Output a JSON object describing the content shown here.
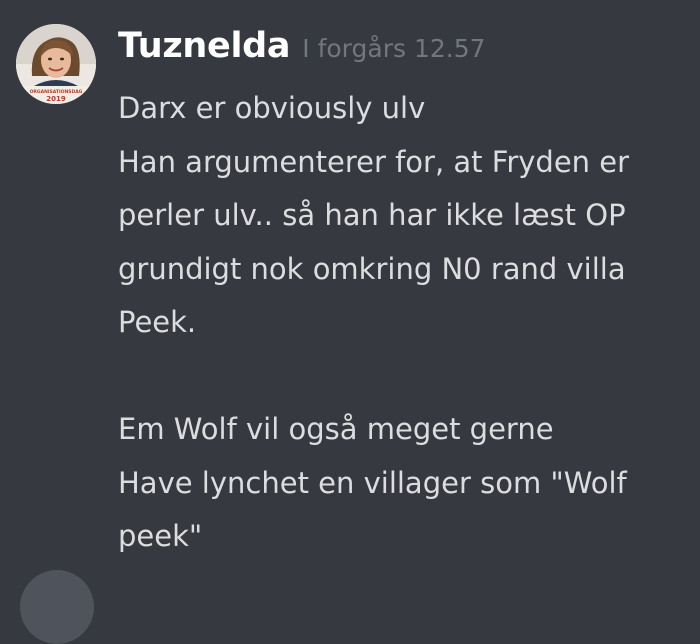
{
  "message": {
    "author": "Tuznelda",
    "timestamp": "I forgårs 12.57",
    "avatar": {
      "badge_text": "ORGANISATIONSDAG",
      "badge_year": "2019",
      "badge_color": "#c0392b"
    },
    "lines": [
      "Darx er obviously ulv",
      "Han argumenterer for, at Fryden er",
      "perler ulv.. så han har ikke læst OP",
      "grundigt nok omkring N0 rand villa",
      "Peek.",
      "",
      "Em Wolf vil også meget gerne",
      "Have lynchet en villager som \"Wolf",
      "peek\""
    ]
  },
  "next_message": {
    "author": ""
  },
  "colors": {
    "background": "#36393f",
    "username": "#ffffff",
    "timestamp": "#72767d",
    "text": "#dcddde"
  }
}
